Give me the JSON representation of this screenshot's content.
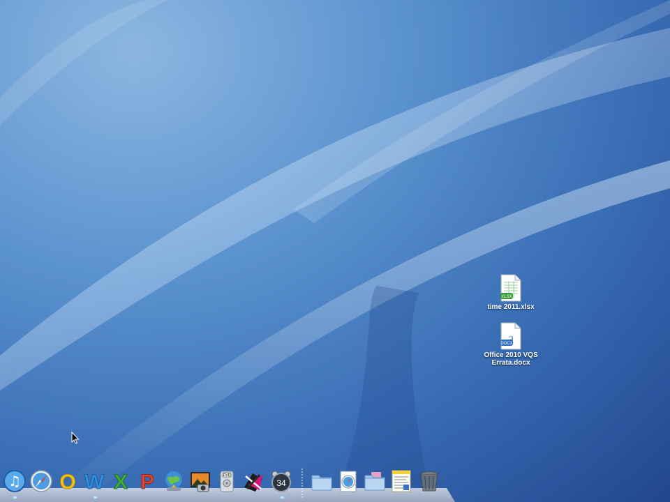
{
  "desktop": {
    "icons": [
      {
        "name": "xlsx-file",
        "label": "time 2011.xlsx",
        "badge": "XLSX",
        "accent": "#3a9a3a"
      },
      {
        "name": "docx-file",
        "label": "Office 2010 VQS Errata.docx",
        "badge": "DOCX",
        "accent": "#2f6fc0"
      }
    ]
  },
  "dock": {
    "apps": [
      {
        "name": "itunes-icon"
      },
      {
        "name": "safari-icon"
      },
      {
        "name": "outlook-icon",
        "glyph": "O",
        "color": "#f2c21a"
      },
      {
        "name": "word-icon",
        "glyph": "W",
        "color": "#2f8fe0"
      },
      {
        "name": "excel-icon",
        "glyph": "X",
        "color": "#3fae3a"
      },
      {
        "name": "powerpoint-icon",
        "glyph": "P",
        "color": "#e0432b"
      },
      {
        "name": "network-globe-icon"
      },
      {
        "name": "photo-booth-icon"
      },
      {
        "name": "dvd-player-icon",
        "glyph": "DVD"
      },
      {
        "name": "app-pink-icon"
      },
      {
        "name": "alarm-clock-icon",
        "glyph": "34"
      }
    ],
    "docs": [
      {
        "name": "applications-folder-icon"
      },
      {
        "name": "downloads-stack-icon"
      },
      {
        "name": "documents-folder-icon"
      },
      {
        "name": "preview-stack-icon"
      },
      {
        "name": "trash-icon"
      }
    ]
  }
}
